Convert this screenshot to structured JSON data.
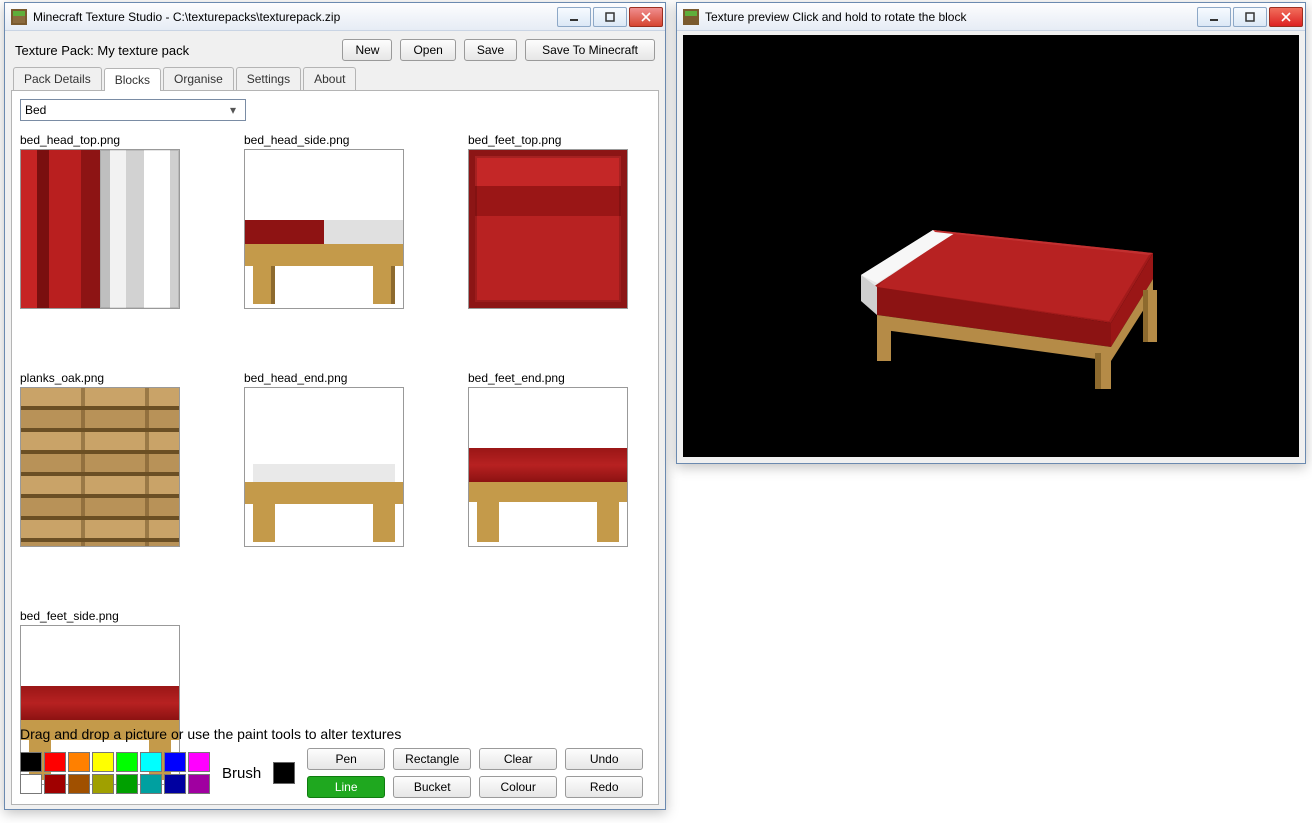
{
  "mainWindow": {
    "title": "Minecraft Texture Studio - C:\\texturepacks\\texturepack.zip",
    "texturePackLabel": "Texture Pack: My texture pack",
    "buttons": {
      "new": "New",
      "open": "Open",
      "save": "Save",
      "saveToMinecraft": "Save To Minecraft"
    },
    "tabs": [
      "Pack Details",
      "Blocks",
      "Organise",
      "Settings",
      "About"
    ],
    "activeTab": "Blocks",
    "blockSelector": "Bed",
    "textures": [
      "bed_head_top.png",
      "bed_head_side.png",
      "bed_feet_top.png",
      "planks_oak.png",
      "bed_head_end.png",
      "bed_feet_end.png",
      "bed_feet_side.png"
    ],
    "hint": "Drag and drop a picture or use the paint tools to alter textures",
    "brushLabel": "Brush",
    "paletteRow1": [
      "#000000",
      "#ff0000",
      "#ff8000",
      "#ffff00",
      "#00ff00",
      "#00ffff",
      "#0000ff",
      "#ff00ff"
    ],
    "paletteRow2": [
      "#ffffff",
      "#a00000",
      "#a05000",
      "#a0a000",
      "#00a000",
      "#00a0a0",
      "#0000a0",
      "#a000a0"
    ],
    "brushColor": "#000000",
    "tools": {
      "pen": "Pen",
      "rectangle": "Rectangle",
      "clear": "Clear",
      "undo": "Undo",
      "line": "Line",
      "bucket": "Bucket",
      "colour": "Colour",
      "redo": "Redo"
    }
  },
  "previewWindow": {
    "title": "Texture preview    Click and hold to rotate the block"
  }
}
